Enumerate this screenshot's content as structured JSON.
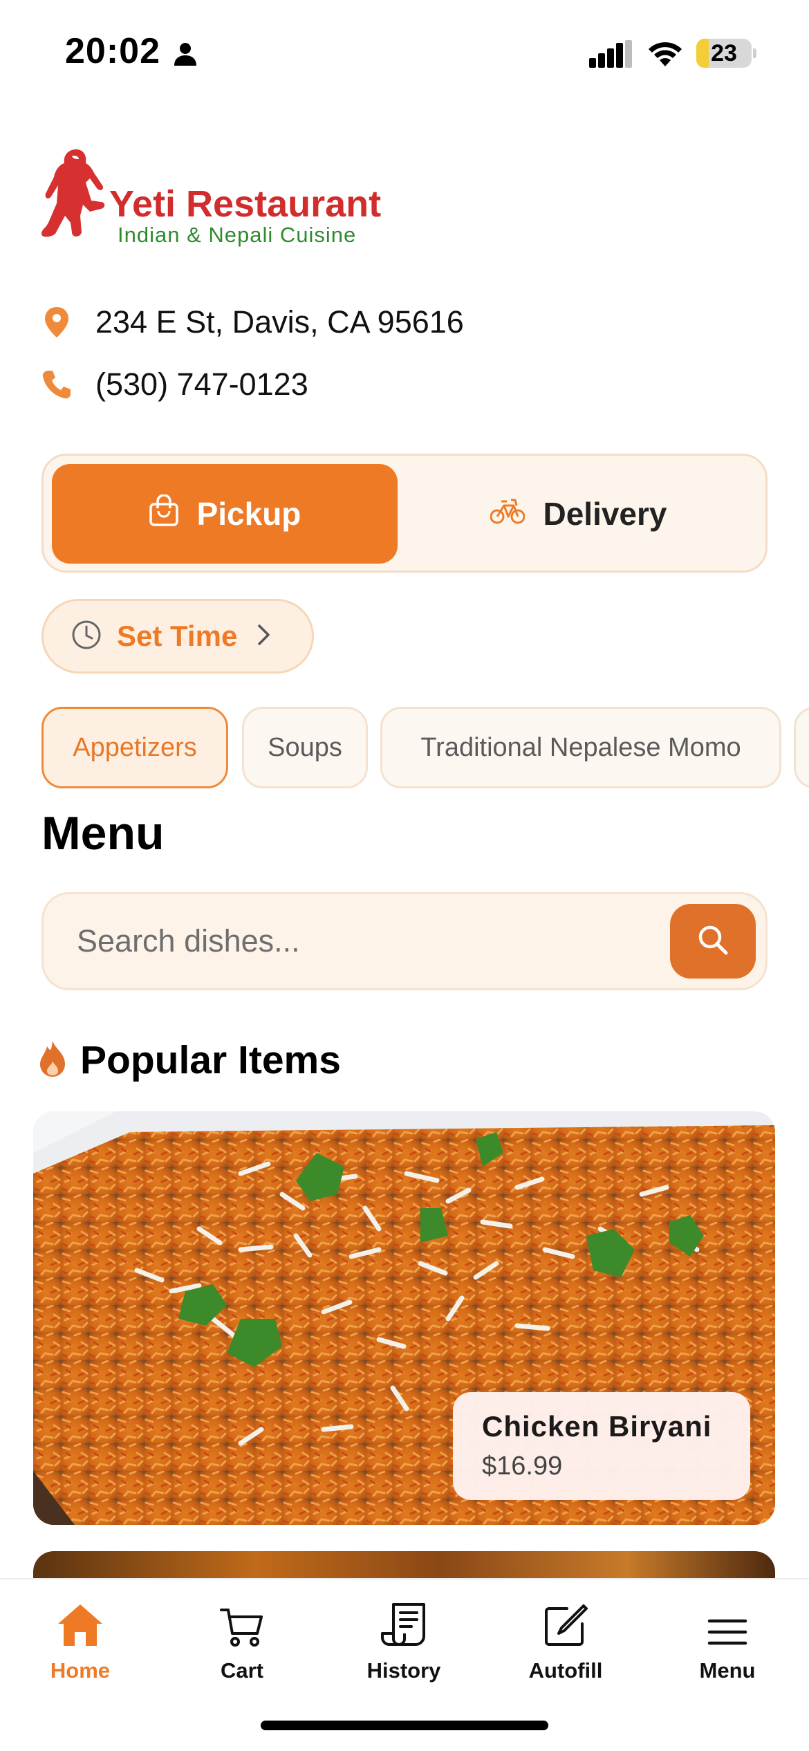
{
  "status_bar": {
    "time": "20:02",
    "battery_level": "23",
    "battery_fraction": 0.23,
    "icons": [
      "person-icon",
      "signal-icon",
      "wifi-icon",
      "battery-icon"
    ]
  },
  "brand": {
    "name": "Yeti Restaurant",
    "tagline": "Indian & Nepali Cuisine",
    "title_color": "#d22d2d",
    "tagline_color": "#2e8b2e"
  },
  "info": {
    "address": "234 E St, Davis, CA 95616",
    "phone": "(530) 747-0123"
  },
  "order_mode": {
    "pickup_label": "Pickup",
    "delivery_label": "Delivery",
    "selected": "Pickup"
  },
  "set_time": {
    "label": "Set Time"
  },
  "categories": [
    {
      "label": "Appetizers",
      "active": true
    },
    {
      "label": "Soups",
      "active": false
    },
    {
      "label": "Traditional Nepalese Momo",
      "active": false
    }
  ],
  "menu": {
    "title": "Menu",
    "search_placeholder": "Search dishes..."
  },
  "popular": {
    "title": "Popular Items",
    "items": [
      {
        "name": "Chicken Biryani",
        "price": "$16.99"
      }
    ]
  },
  "tabbar": {
    "items": [
      {
        "label": "Home",
        "icon": "home-icon",
        "active": true
      },
      {
        "label": "Cart",
        "icon": "cart-icon",
        "active": false
      },
      {
        "label": "History",
        "icon": "receipt-icon",
        "active": false
      },
      {
        "label": "Autofill",
        "icon": "edit-icon",
        "active": false
      },
      {
        "label": "Menu",
        "icon": "hamburger-icon",
        "active": false
      }
    ]
  },
  "colors": {
    "accent": "#ef7a26",
    "chip_border_active": "#ef8a3a",
    "search_button": "#e0712b"
  }
}
